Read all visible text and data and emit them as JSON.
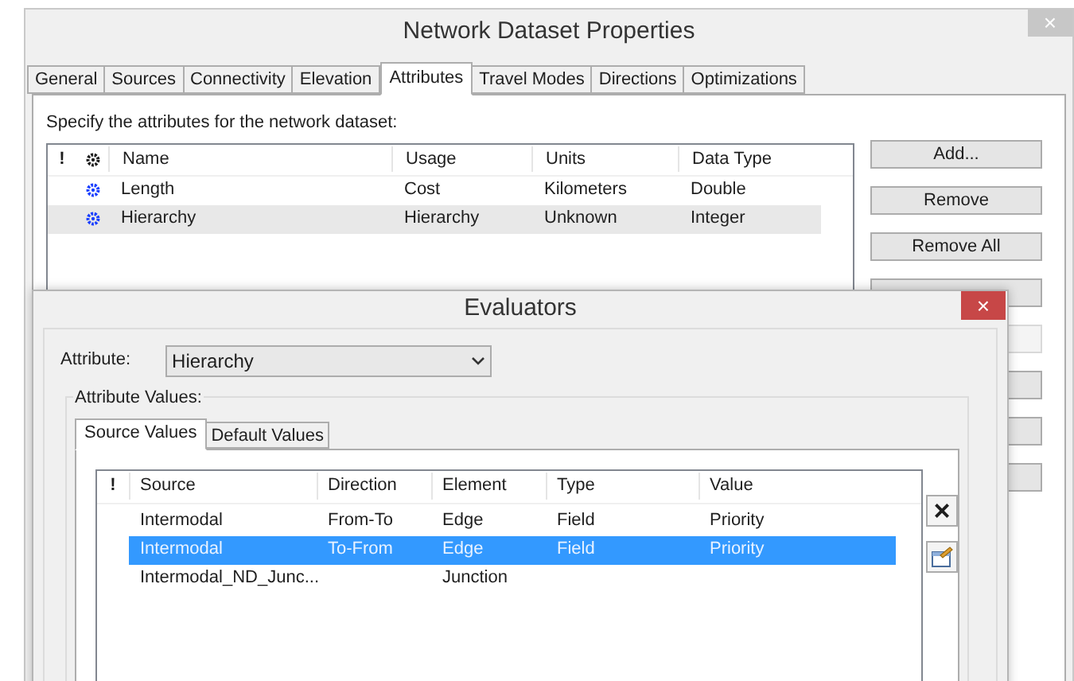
{
  "window": {
    "title": "Network Dataset Properties",
    "close": "×"
  },
  "tabs": [
    {
      "label": "General",
      "selected": false
    },
    {
      "label": "Sources",
      "selected": false
    },
    {
      "label": "Connectivity",
      "selected": false
    },
    {
      "label": "Elevation",
      "selected": false
    },
    {
      "label": "Attributes",
      "selected": true
    },
    {
      "label": "Travel Modes",
      "selected": false
    },
    {
      "label": "Directions",
      "selected": false
    },
    {
      "label": "Optimizations",
      "selected": false
    }
  ],
  "attributes": {
    "instruction": "Specify the attributes for the network dataset:",
    "error_column": "!",
    "columns": [
      "Name",
      "Usage",
      "Units",
      "Data Type"
    ],
    "rows": [
      {
        "cells": [
          "Length",
          "Cost",
          "Kilometers",
          "Double"
        ],
        "selected": false
      },
      {
        "cells": [
          "Hierarchy",
          "Hierarchy",
          "Unknown",
          "Integer"
        ],
        "selected": true
      }
    ]
  },
  "buttons": [
    {
      "label": "Add...",
      "disabled": false
    },
    {
      "label": "Remove",
      "disabled": false
    },
    {
      "label": "Remove All",
      "disabled": false
    },
    {
      "disabled": false
    },
    {
      "disabled": true
    },
    {
      "disabled": false
    },
    {
      "disabled": false
    },
    {
      "disabled": false
    }
  ],
  "evaluators": {
    "title": "Evaluators",
    "close": "×",
    "attribute_label": "Attribute:",
    "attribute_value": "Hierarchy",
    "group_label": "Attribute Values:",
    "tabs": [
      {
        "label": "Source Values",
        "selected": true
      },
      {
        "label": "Default Values",
        "selected": false
      }
    ],
    "columns": [
      "!",
      "Source",
      "Direction",
      "Element",
      "Type",
      "Value"
    ],
    "rows": [
      {
        "cells": [
          "",
          "Intermodal",
          "From-To",
          "Edge",
          "Field",
          "Priority"
        ],
        "selected": false
      },
      {
        "cells": [
          "",
          "Intermodal",
          "To-From",
          "Edge",
          "Field",
          "Priority"
        ],
        "selected": true
      },
      {
        "cells": [
          "",
          "Intermodal_ND_Junc...",
          "",
          "Junction",
          "",
          ""
        ],
        "selected": false
      }
    ],
    "delete_symbol": "×"
  }
}
